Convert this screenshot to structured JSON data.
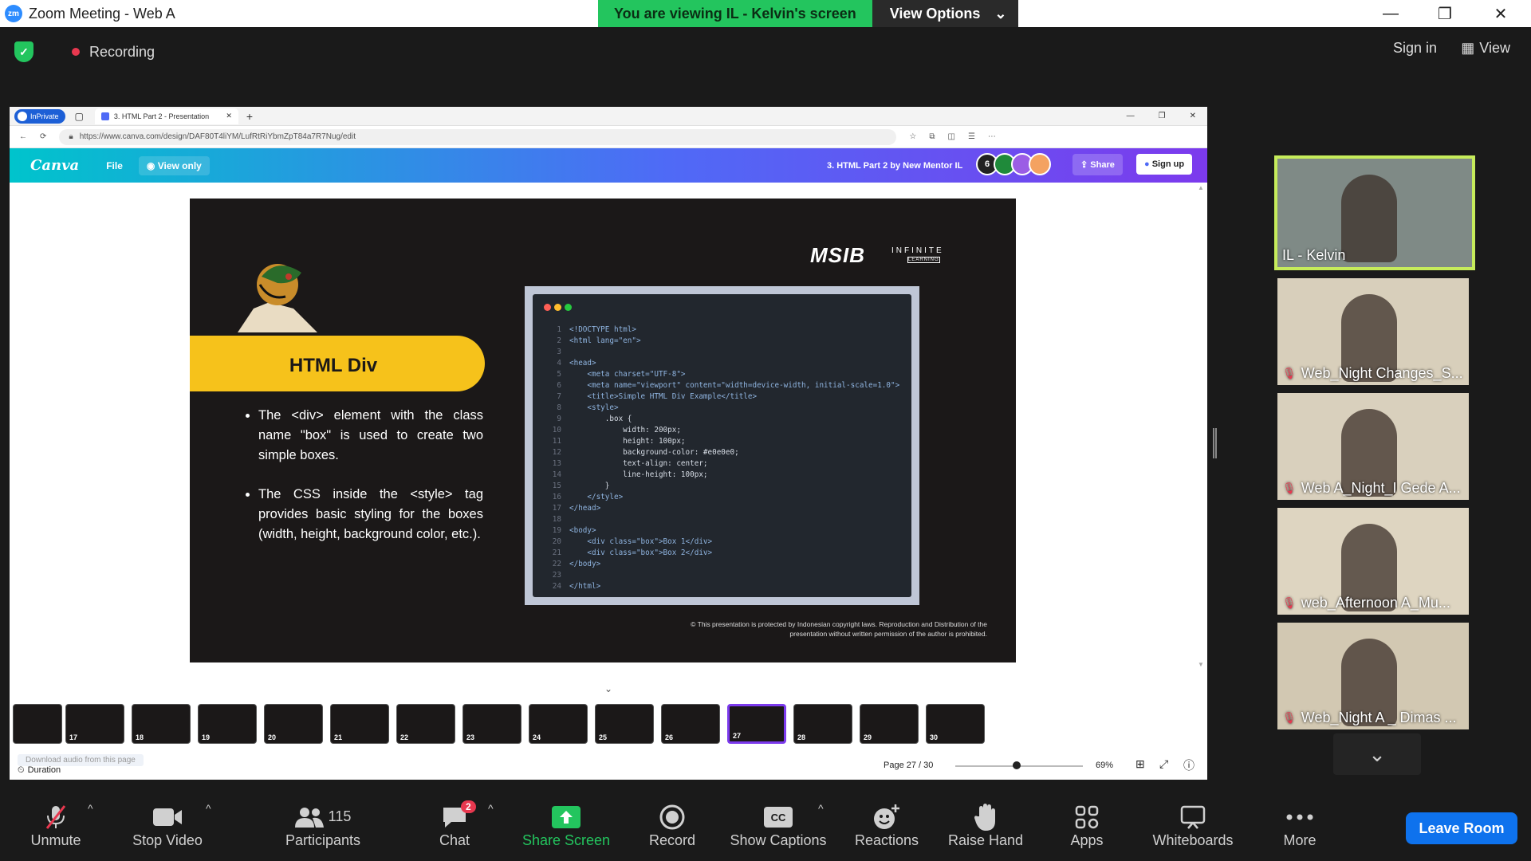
{
  "window": {
    "title": "Zoom Meeting - Web A",
    "logo_text": "zm",
    "minimize": "—",
    "restore": "❐",
    "close": "✕"
  },
  "share_banner": {
    "status": "You are viewing IL - Kelvin's screen",
    "options_label": "View Options",
    "options_caret": "⌄"
  },
  "topbar": {
    "recording_label": "Recording",
    "signin_label": "Sign in",
    "view_label": "View"
  },
  "browser": {
    "inprivate_label": "InPrivate",
    "tab_title": "3. HTML Part 2 - Presentation",
    "tab_close": "✕",
    "new_tab": "+",
    "url": "https://www.canva.com/design/DAF80T4liYM/LufRtRiYbmZpT84a7R7Nug/edit"
  },
  "canva": {
    "logo": "Canva",
    "file_label": "File",
    "view_only_label": "View only",
    "doc_title": "3. HTML Part 2 by New Mentor IL",
    "avatars": [
      {
        "text": "6",
        "color": "#222222"
      },
      {
        "text": "",
        "color": "#1f8a3a"
      },
      {
        "text": "",
        "color": "#9b5de5"
      },
      {
        "text": "",
        "color": "#f4a261"
      }
    ],
    "share_label": "Share",
    "signup_label": "Sign up"
  },
  "slide": {
    "brand": "MSIB",
    "brand_sub": "INFINITE",
    "brand_tag": "LEARNING",
    "title": "HTML Div",
    "bullets": [
      "The <div> element with the class name \"box\" is used to create two simple boxes.",
      "The CSS inside the <style> tag provides basic styling for the boxes (width, height, background color, etc.)."
    ],
    "code_lines": [
      "<!DOCTYPE html>",
      "<html lang=\"en\">",
      "",
      "<head>",
      "    <meta charset=\"UTF-8\">",
      "    <meta name=\"viewport\" content=\"width=device-width, initial-scale=1.0\">",
      "    <title>Simple HTML Div Example</title>",
      "    <style>",
      "        .box {",
      "            width: 200px;",
      "            height: 100px;",
      "            background-color: #e0e0e0;",
      "            text-align: center;",
      "            line-height: 100px;",
      "        }",
      "    </style>",
      "</head>",
      "",
      "<body>",
      "    <div class=\"box\">Box 1</div>",
      "    <div class=\"box\">Box 2</div>",
      "</body>",
      "",
      "</html>"
    ],
    "copyright": "© This presentation is protected by Indonesian copyright laws. Reproduction and Distribution of the presentation without written permission of the author is prohibited."
  },
  "thumbnails": [
    {
      "num": ""
    },
    {
      "num": "17"
    },
    {
      "num": "18"
    },
    {
      "num": "19"
    },
    {
      "num": "20"
    },
    {
      "num": "21"
    },
    {
      "num": "22"
    },
    {
      "num": "23"
    },
    {
      "num": "24"
    },
    {
      "num": "25"
    },
    {
      "num": "26"
    },
    {
      "num": "27"
    },
    {
      "num": "28"
    },
    {
      "num": "29"
    },
    {
      "num": "30"
    }
  ],
  "footer": {
    "duration_label": "Duration",
    "download_label": "Download audio from this page",
    "page_label": "Page 27 / 30",
    "zoom_level": "69%",
    "zoom_fraction": 0.48
  },
  "participants_tiles": [
    {
      "name": "IL - Kelvin",
      "muted": false,
      "bg": "#7f8a86"
    },
    {
      "name": "Web_Night Changes_S...",
      "muted": true,
      "bg": "#d8cfbb"
    },
    {
      "name": "Web A_Night_I Gede A...",
      "muted": true,
      "bg": "#d9d0bd"
    },
    {
      "name": "web_Afternoon A_Mu...",
      "muted": true,
      "bg": "#ded5c1"
    },
    {
      "name": "Web_Night A _ Dimas ...",
      "muted": true,
      "bg": "#d2c8b2"
    }
  ],
  "sidebar_more_icon": "⌄",
  "toolbar": {
    "unmute": "Unmute",
    "stop_video": "Stop Video",
    "participants": "Participants",
    "participants_count": "115",
    "chat": "Chat",
    "chat_badge": "2",
    "share_screen": "Share Screen",
    "record": "Record",
    "show_captions": "Show Captions",
    "reactions": "Reactions",
    "raise_hand": "Raise Hand",
    "apps": "Apps",
    "whiteboards": "Whiteboards",
    "more": "More",
    "leave": "Leave Room"
  },
  "colors": {
    "share_green": "#23c55e",
    "slide_yellow": "#f6c21b",
    "leave_blue": "#0e72ed",
    "active_tile": "#c6ec5b"
  }
}
